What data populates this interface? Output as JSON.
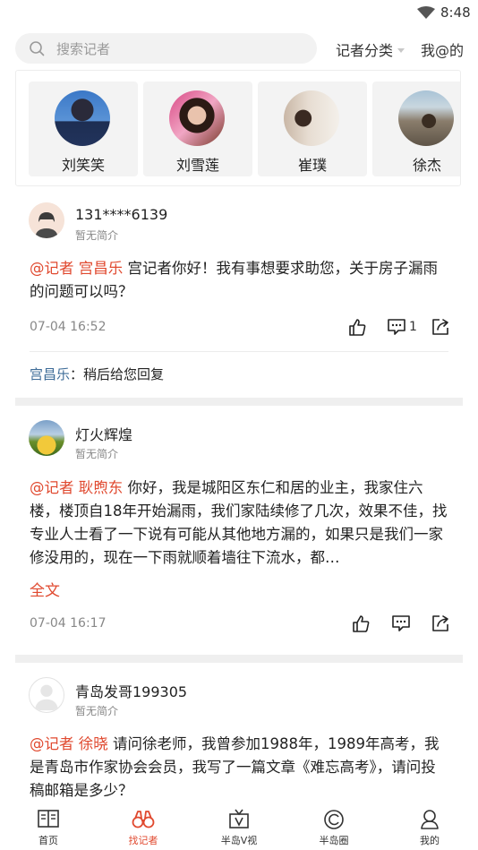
{
  "status_bar": {
    "time": "8:48"
  },
  "header": {
    "search_placeholder": "搜索记者",
    "category_label": "记者分类",
    "mine_label": "我@的"
  },
  "reporters": [
    {
      "name": "刘笑笑"
    },
    {
      "name": "刘雪莲"
    },
    {
      "name": "崔璞"
    },
    {
      "name": "徐杰"
    }
  ],
  "posts": [
    {
      "user": "131****6139",
      "intro": "暂无简介",
      "mention": "@记者 宫昌乐",
      "text": " 宫记者你好！我有事想要求助您，关于房子漏雨的问题可以吗？",
      "time": "07-04 16:52",
      "comment_count": "1",
      "reply_name": "宫昌乐",
      "reply_text": "：稍后给您回复"
    },
    {
      "user": "灯火辉煌",
      "intro": "暂无简介",
      "mention": "@记者 耿煦东",
      "text": " 你好，我是城阳区东仁和居的业主，我家住六楼，楼顶自18年开始漏雨，我们家陆续修了几次，效果不佳，找专业人士看了一下说有可能从其他地方漏的，如果只是我们一家修没用的，现在一下雨就顺着墙往下流水，都…",
      "more": "全文",
      "time": "07-04 16:17"
    },
    {
      "user": "青岛发哥199305",
      "intro": "暂无简介",
      "mention": "@记者 徐晓",
      "text": " 请问徐老师，我曾参加1988年，1989年高考，我是青岛市作家协会会员，我写了一篇文章《难忘高考》，请问投稿邮箱是多少？"
    }
  ],
  "tabs": [
    {
      "label": "首页"
    },
    {
      "label": "找记者"
    },
    {
      "label": "半岛V视"
    },
    {
      "label": "半岛圈"
    },
    {
      "label": "我的"
    }
  ],
  "colors": {
    "accent": "#e0492f",
    "reply_name": "#3e6c98",
    "separator": "#efefef"
  }
}
